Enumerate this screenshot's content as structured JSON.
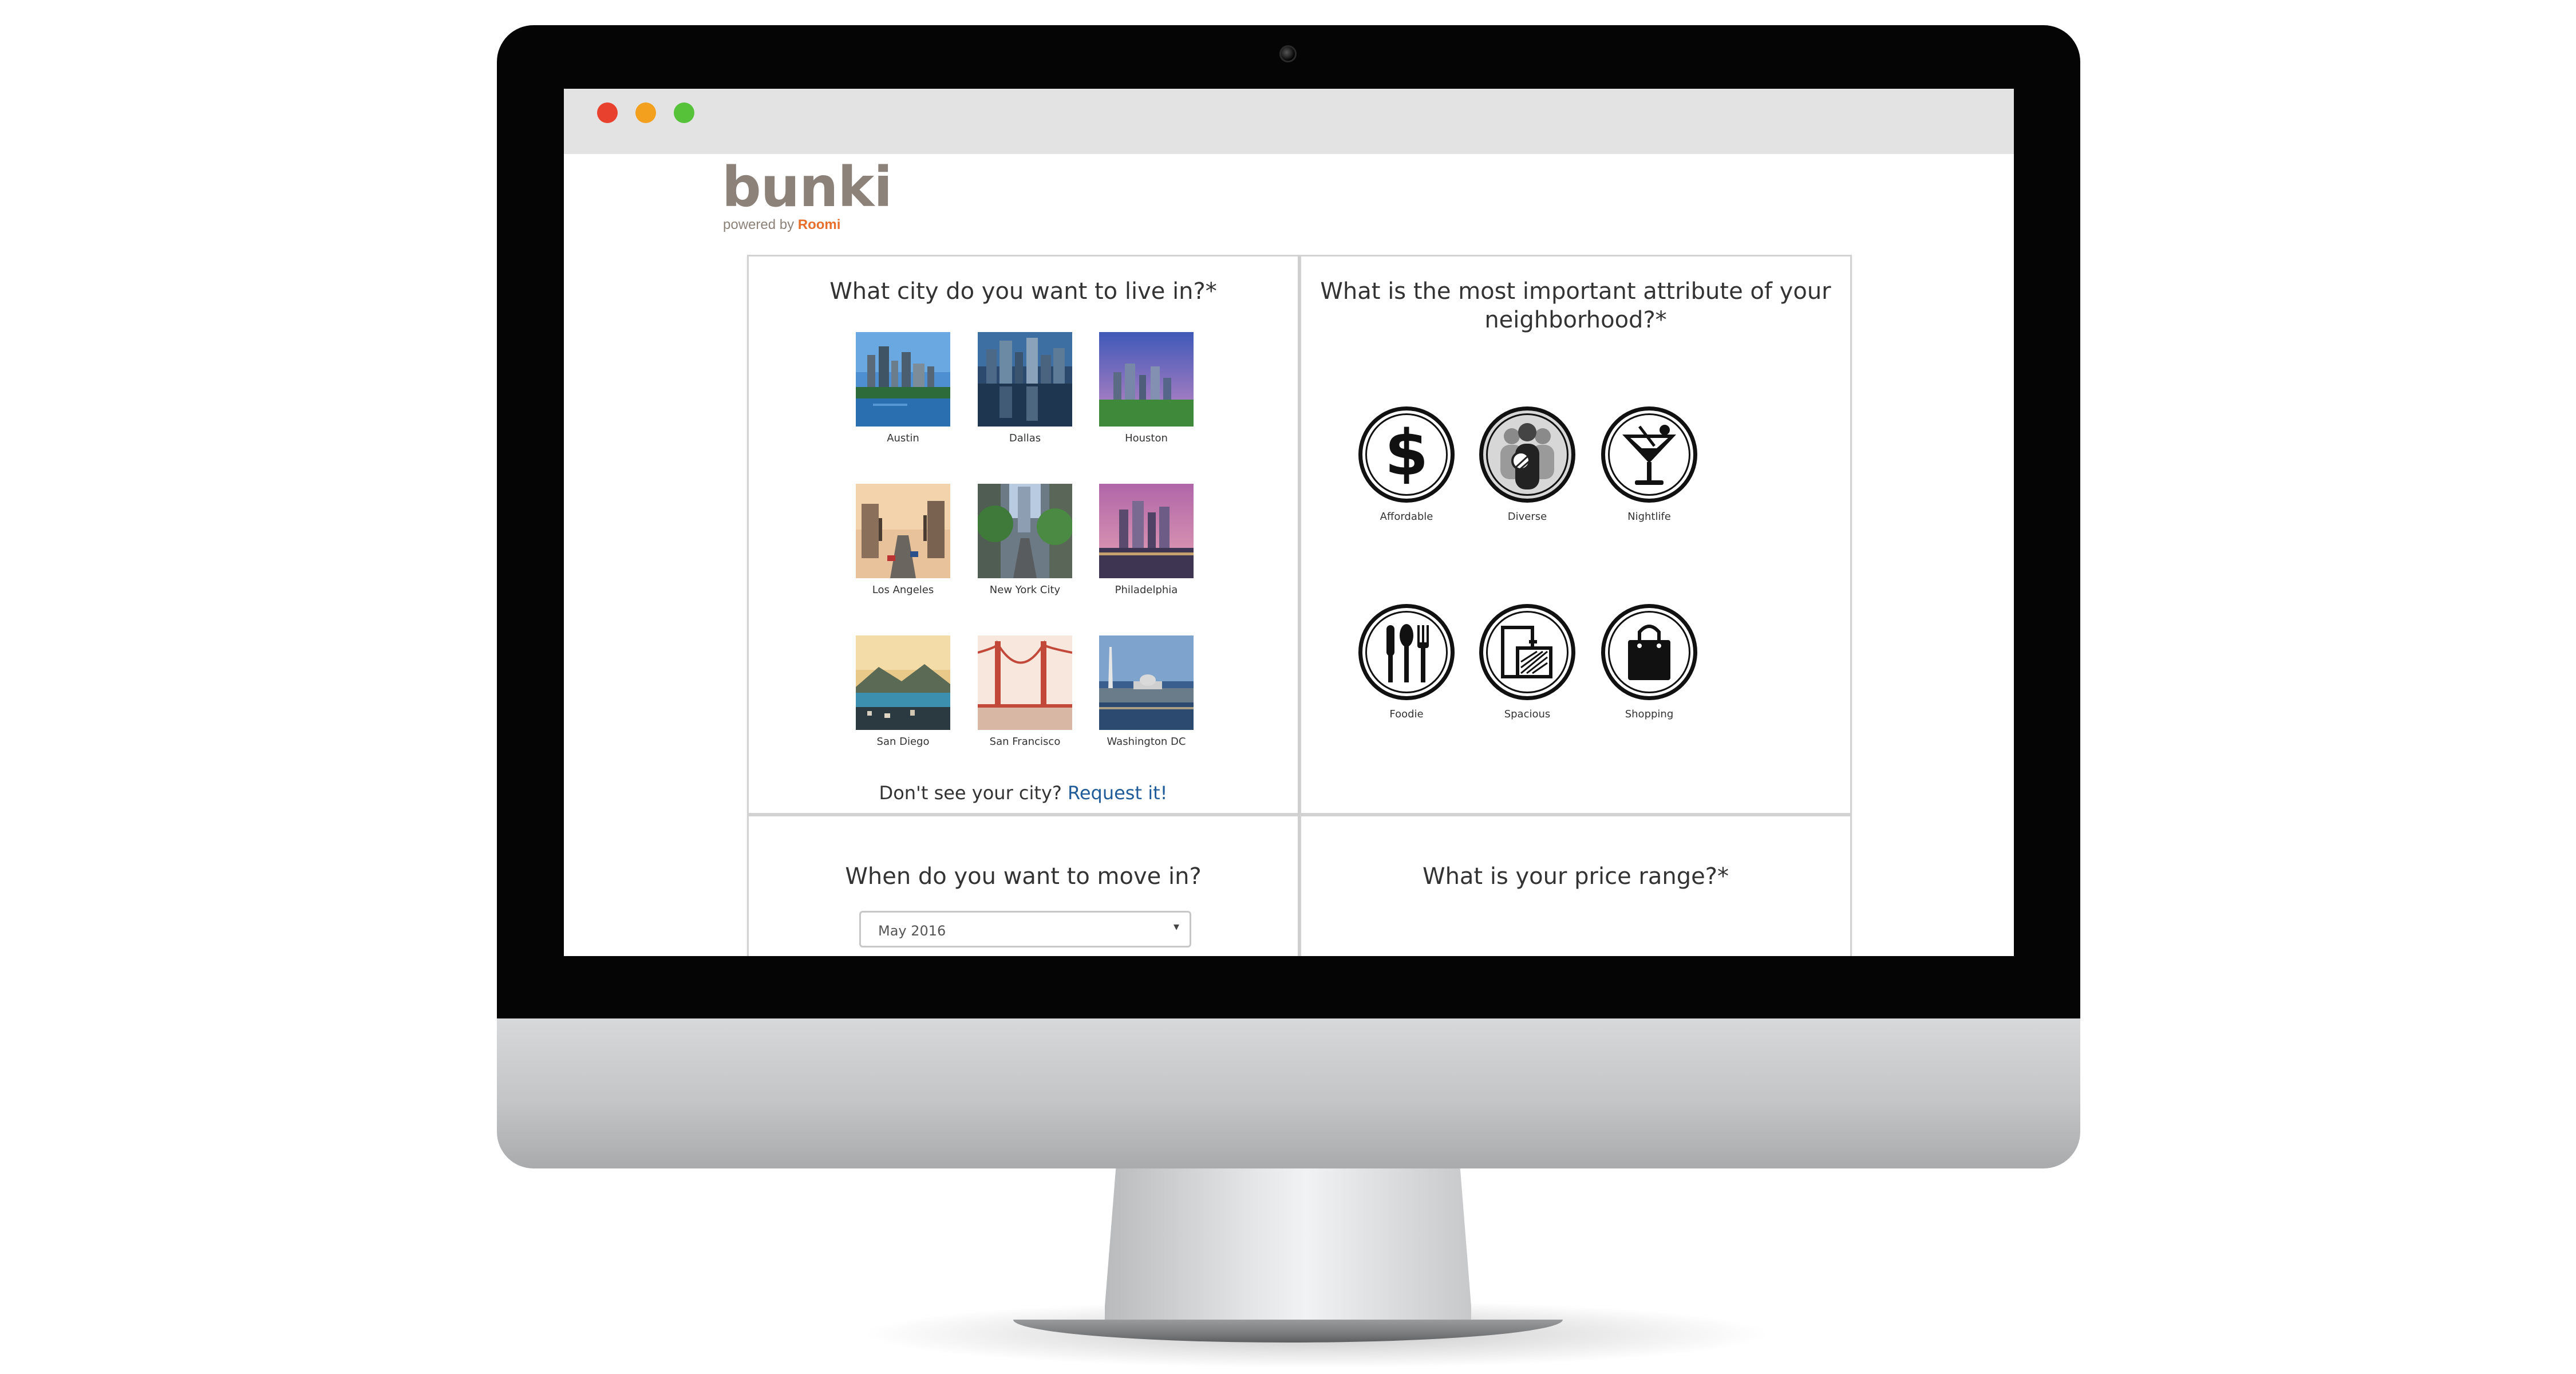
{
  "window": {
    "controls": [
      {
        "name": "close",
        "color": "#e8412e"
      },
      {
        "name": "minimize",
        "color": "#f2a01d"
      },
      {
        "name": "maximize",
        "color": "#55c23a"
      }
    ]
  },
  "brand": {
    "logo": "bunki",
    "powered_by": "powered by",
    "partner": "Roomi"
  },
  "city_section": {
    "title": "What city do you want to live in?*",
    "cities": [
      {
        "label": "Austin"
      },
      {
        "label": "Dallas"
      },
      {
        "label": "Houston"
      },
      {
        "label": "Los Angeles"
      },
      {
        "label": "New York City"
      },
      {
        "label": "Philadelphia"
      },
      {
        "label": "San Diego"
      },
      {
        "label": "San Francisco"
      },
      {
        "label": "Washington DC"
      }
    ],
    "request_prompt": "Don't see your city?",
    "request_link": "Request it!"
  },
  "attribute_section": {
    "title": "What is the most important attribute of your neighborhood?*",
    "options": [
      {
        "label": "Affordable",
        "icon": "dollar-icon"
      },
      {
        "label": "Diverse",
        "icon": "people-icon"
      },
      {
        "label": "Nightlife",
        "icon": "cocktail-icon"
      },
      {
        "label": "Foodie",
        "icon": "utensils-icon"
      },
      {
        "label": "Spacious",
        "icon": "floorplan-icon"
      },
      {
        "label": "Shopping",
        "icon": "shopping-bag-icon"
      }
    ]
  },
  "move_section": {
    "title": "When do you want to move in?",
    "selected": "May 2016",
    "arrow": "▾"
  },
  "price_section": {
    "title": "What is your price range?*"
  }
}
